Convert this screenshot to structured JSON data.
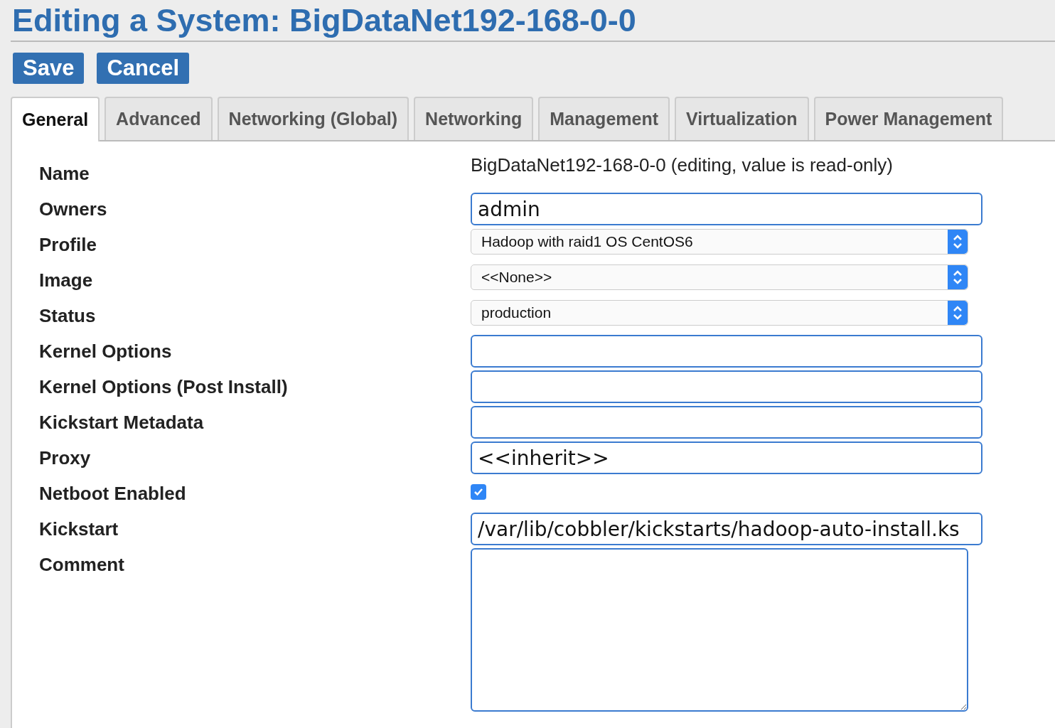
{
  "title": "Editing a System: BigDataNet192-168-0-0",
  "buttons": [
    "Save",
    "Cancel"
  ],
  "tabs": [
    {
      "label": "General",
      "selected": true
    },
    {
      "label": "Advanced",
      "selected": false
    },
    {
      "label": "Networking (Global)",
      "selected": false
    },
    {
      "label": "Networking",
      "selected": false
    },
    {
      "label": "Management",
      "selected": false
    },
    {
      "label": "Virtualization",
      "selected": false
    },
    {
      "label": "Power Management",
      "selected": false
    }
  ],
  "fields": [
    {
      "label": "Name",
      "kind": "static",
      "value": "BigDataNet192-168-0-0 (editing, value is read-only)"
    },
    {
      "label": "Owners",
      "kind": "input",
      "value": "admin"
    },
    {
      "label": "Profile",
      "kind": "select",
      "value": "Hadoop with raid1 OS CentOS6"
    },
    {
      "label": "Image",
      "kind": "select",
      "value": "<<None>>"
    },
    {
      "label": "Status",
      "kind": "select",
      "value": "production"
    },
    {
      "label": "Kernel Options",
      "kind": "input"
    },
    {
      "label": "Kernel Options (Post Install)",
      "kind": "input"
    },
    {
      "label": "Kickstart Metadata",
      "kind": "input"
    },
    {
      "label": "Proxy",
      "kind": "input",
      "value": "<<inherit>>"
    },
    {
      "label": "Netboot Enabled",
      "kind": "checkbox",
      "checked": true
    },
    {
      "label": "Kickstart",
      "kind": "input",
      "value": "/var/lib/cobbler/kickstarts/hadoop-auto-install.ks"
    },
    {
      "label": "Comment",
      "kind": "textarea"
    }
  ]
}
